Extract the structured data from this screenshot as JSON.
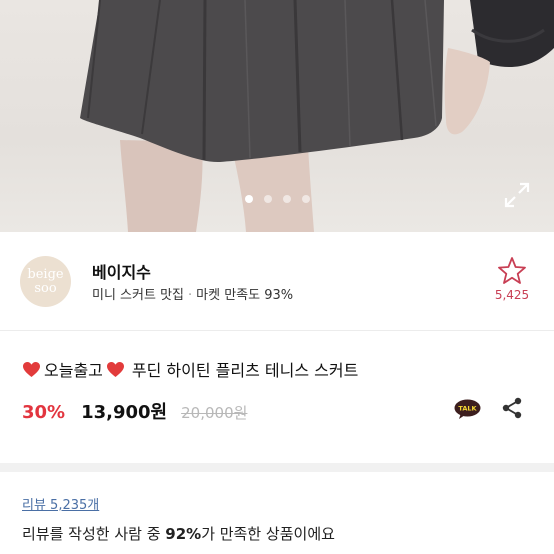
{
  "carousel": {
    "slide_count": 4,
    "active_index": 0
  },
  "seller": {
    "logo_line1": "beige",
    "logo_line2": "soo",
    "name": "베이지수",
    "tagline": "미니 스커트 맛집",
    "market_satisfaction_label": "마켓 만족도 93%",
    "favorite_count": "5,425"
  },
  "product": {
    "title_prefix": "오늘출고",
    "title": "푸딘 하이틴 플리츠 테니스 스커트",
    "discount": "30%",
    "price": "13,900원",
    "original_price": "20,000원",
    "talk_label": "TALK"
  },
  "review": {
    "count_label": "리뷰 5,235개",
    "summary_before": "리뷰를 작성한 사람 중 ",
    "summary_percent": "92%",
    "summary_after": "가 만족한 상품이에요"
  },
  "colors": {
    "discount": "#e2353f",
    "favorite": "#c83f54",
    "review_link": "#4a6fa5",
    "heart": "#e23b3b",
    "talk_badge": "#3c1e1e"
  }
}
